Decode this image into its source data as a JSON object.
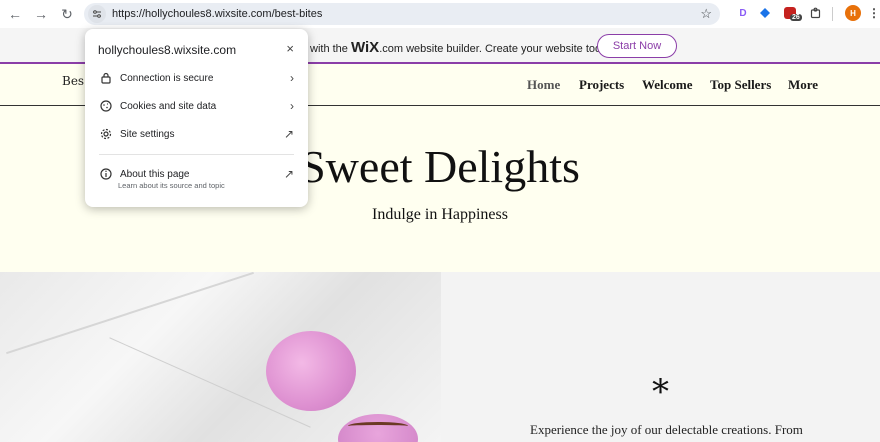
{
  "browser": {
    "url": "https://hollychoules8.wixsite.com/best-bites",
    "back": "←",
    "forward": "→",
    "reload": "↻",
    "star": "☆",
    "ext_d": "D",
    "ext_badge": "26",
    "profile": "H"
  },
  "wix_banner": {
    "prefix": "with the",
    "brand": "WiX",
    "suffix": ".com website builder. Create your website today.",
    "button": "Start Now"
  },
  "site": {
    "logo": "Bes",
    "nav": [
      "Home",
      "Projects",
      "Welcome",
      "Top Sellers",
      "More"
    ],
    "hero_title": "Sweet Delights",
    "hero_subtitle": "Indulge in Happiness",
    "asterisk": "*",
    "panel_text": "Experience the joy of our delectable creations. From"
  },
  "popup": {
    "title": "hollychoules8.wixsite.com",
    "close": "×",
    "items": [
      {
        "label": "Connection is secure",
        "icon": "lock-icon",
        "end": "›"
      },
      {
        "label": "Cookies and site data",
        "icon": "cookie-icon",
        "end": "›"
      },
      {
        "label": "Site settings",
        "icon": "gear-icon",
        "end": "↗"
      },
      {
        "label": "About this page",
        "icon": "info-icon",
        "end": "↗"
      }
    ],
    "about_sub": "Learn about its source and topic"
  },
  "colors": {
    "accent": "#8b3ea8",
    "hero_bg": "#fffff0"
  }
}
